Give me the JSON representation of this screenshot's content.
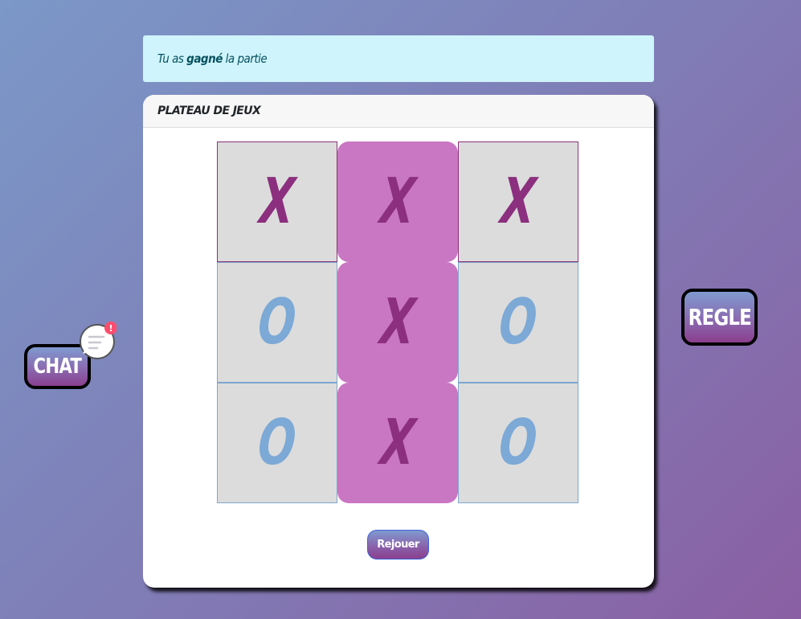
{
  "alert": {
    "prefix": "Tu as ",
    "bold": "gagné",
    "suffix": " la partie"
  },
  "card": {
    "title": "PLATEAU DE JEUX"
  },
  "board": {
    "cells": [
      "X",
      "X",
      "X",
      "O",
      "X",
      "O",
      "O",
      "X",
      "O"
    ],
    "winning_column": 1
  },
  "replay_label": "Rejouer",
  "chat": {
    "label": "CHAT",
    "badge": "!",
    "icon": "chat-bubble-icon"
  },
  "rules_label": "REGLE",
  "colors": {
    "x": "#8b2f7e",
    "o": "#7ca9d6",
    "win_cell": "#c977c2",
    "alert_bg": "#cff4fc"
  }
}
